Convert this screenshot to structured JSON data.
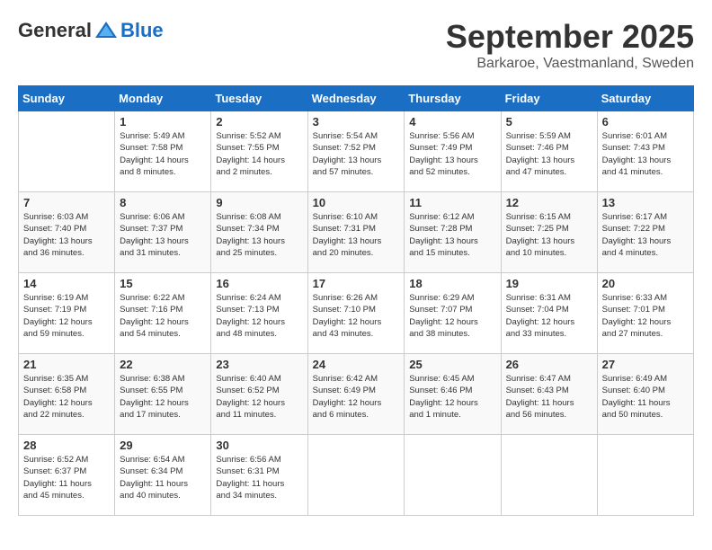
{
  "header": {
    "logo_general": "General",
    "logo_blue": "Blue",
    "month_title": "September 2025",
    "location": "Barkaroe, Vaestmanland, Sweden"
  },
  "days_of_week": [
    "Sunday",
    "Monday",
    "Tuesday",
    "Wednesday",
    "Thursday",
    "Friday",
    "Saturday"
  ],
  "weeks": [
    [
      {
        "day": "",
        "info": ""
      },
      {
        "day": "1",
        "info": "Sunrise: 5:49 AM\nSunset: 7:58 PM\nDaylight: 14 hours\nand 8 minutes."
      },
      {
        "day": "2",
        "info": "Sunrise: 5:52 AM\nSunset: 7:55 PM\nDaylight: 14 hours\nand 2 minutes."
      },
      {
        "day": "3",
        "info": "Sunrise: 5:54 AM\nSunset: 7:52 PM\nDaylight: 13 hours\nand 57 minutes."
      },
      {
        "day": "4",
        "info": "Sunrise: 5:56 AM\nSunset: 7:49 PM\nDaylight: 13 hours\nand 52 minutes."
      },
      {
        "day": "5",
        "info": "Sunrise: 5:59 AM\nSunset: 7:46 PM\nDaylight: 13 hours\nand 47 minutes."
      },
      {
        "day": "6",
        "info": "Sunrise: 6:01 AM\nSunset: 7:43 PM\nDaylight: 13 hours\nand 41 minutes."
      }
    ],
    [
      {
        "day": "7",
        "info": "Sunrise: 6:03 AM\nSunset: 7:40 PM\nDaylight: 13 hours\nand 36 minutes."
      },
      {
        "day": "8",
        "info": "Sunrise: 6:06 AM\nSunset: 7:37 PM\nDaylight: 13 hours\nand 31 minutes."
      },
      {
        "day": "9",
        "info": "Sunrise: 6:08 AM\nSunset: 7:34 PM\nDaylight: 13 hours\nand 25 minutes."
      },
      {
        "day": "10",
        "info": "Sunrise: 6:10 AM\nSunset: 7:31 PM\nDaylight: 13 hours\nand 20 minutes."
      },
      {
        "day": "11",
        "info": "Sunrise: 6:12 AM\nSunset: 7:28 PM\nDaylight: 13 hours\nand 15 minutes."
      },
      {
        "day": "12",
        "info": "Sunrise: 6:15 AM\nSunset: 7:25 PM\nDaylight: 13 hours\nand 10 minutes."
      },
      {
        "day": "13",
        "info": "Sunrise: 6:17 AM\nSunset: 7:22 PM\nDaylight: 13 hours\nand 4 minutes."
      }
    ],
    [
      {
        "day": "14",
        "info": "Sunrise: 6:19 AM\nSunset: 7:19 PM\nDaylight: 12 hours\nand 59 minutes."
      },
      {
        "day": "15",
        "info": "Sunrise: 6:22 AM\nSunset: 7:16 PM\nDaylight: 12 hours\nand 54 minutes."
      },
      {
        "day": "16",
        "info": "Sunrise: 6:24 AM\nSunset: 7:13 PM\nDaylight: 12 hours\nand 48 minutes."
      },
      {
        "day": "17",
        "info": "Sunrise: 6:26 AM\nSunset: 7:10 PM\nDaylight: 12 hours\nand 43 minutes."
      },
      {
        "day": "18",
        "info": "Sunrise: 6:29 AM\nSunset: 7:07 PM\nDaylight: 12 hours\nand 38 minutes."
      },
      {
        "day": "19",
        "info": "Sunrise: 6:31 AM\nSunset: 7:04 PM\nDaylight: 12 hours\nand 33 minutes."
      },
      {
        "day": "20",
        "info": "Sunrise: 6:33 AM\nSunset: 7:01 PM\nDaylight: 12 hours\nand 27 minutes."
      }
    ],
    [
      {
        "day": "21",
        "info": "Sunrise: 6:35 AM\nSunset: 6:58 PM\nDaylight: 12 hours\nand 22 minutes."
      },
      {
        "day": "22",
        "info": "Sunrise: 6:38 AM\nSunset: 6:55 PM\nDaylight: 12 hours\nand 17 minutes."
      },
      {
        "day": "23",
        "info": "Sunrise: 6:40 AM\nSunset: 6:52 PM\nDaylight: 12 hours\nand 11 minutes."
      },
      {
        "day": "24",
        "info": "Sunrise: 6:42 AM\nSunset: 6:49 PM\nDaylight: 12 hours\nand 6 minutes."
      },
      {
        "day": "25",
        "info": "Sunrise: 6:45 AM\nSunset: 6:46 PM\nDaylight: 12 hours\nand 1 minute."
      },
      {
        "day": "26",
        "info": "Sunrise: 6:47 AM\nSunset: 6:43 PM\nDaylight: 11 hours\nand 56 minutes."
      },
      {
        "day": "27",
        "info": "Sunrise: 6:49 AM\nSunset: 6:40 PM\nDaylight: 11 hours\nand 50 minutes."
      }
    ],
    [
      {
        "day": "28",
        "info": "Sunrise: 6:52 AM\nSunset: 6:37 PM\nDaylight: 11 hours\nand 45 minutes."
      },
      {
        "day": "29",
        "info": "Sunrise: 6:54 AM\nSunset: 6:34 PM\nDaylight: 11 hours\nand 40 minutes."
      },
      {
        "day": "30",
        "info": "Sunrise: 6:56 AM\nSunset: 6:31 PM\nDaylight: 11 hours\nand 34 minutes."
      },
      {
        "day": "",
        "info": ""
      },
      {
        "day": "",
        "info": ""
      },
      {
        "day": "",
        "info": ""
      },
      {
        "day": "",
        "info": ""
      }
    ]
  ]
}
